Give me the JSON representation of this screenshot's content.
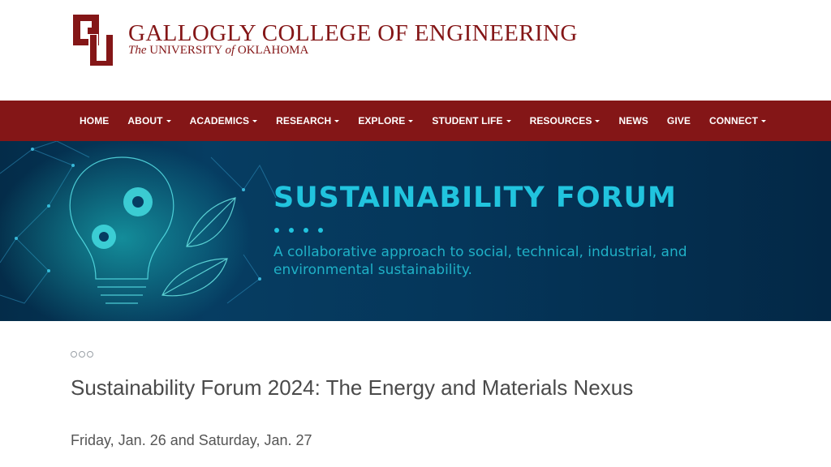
{
  "header": {
    "college_name": "GALLOGLY COLLEGE OF ENGINEERING",
    "university_prefix": "The",
    "university_mid": "UNIVERSITY",
    "university_of": "of",
    "university_state": "OKLAHOMA",
    "brand_color": "#841617"
  },
  "nav": {
    "items": [
      {
        "label": "HOME",
        "dropdown": false
      },
      {
        "label": "ABOUT",
        "dropdown": true
      },
      {
        "label": "ACADEMICS",
        "dropdown": true
      },
      {
        "label": "RESEARCH",
        "dropdown": true
      },
      {
        "label": "EXPLORE",
        "dropdown": true
      },
      {
        "label": "STUDENT LIFE",
        "dropdown": true
      },
      {
        "label": "RESOURCES",
        "dropdown": true
      },
      {
        "label": "NEWS",
        "dropdown": false
      },
      {
        "label": "GIVE",
        "dropdown": false
      },
      {
        "label": "CONNECT",
        "dropdown": true
      }
    ]
  },
  "banner": {
    "title": "SUSTAINABILITY FORUM",
    "subtitle": "A collaborative approach to social, technical, industrial, and environmental sustainability.",
    "accent_color": "#21c4de"
  },
  "content": {
    "title": "Sustainability Forum 2024: The Energy and Materials Nexus",
    "date": "Friday, Jan. 26 and Saturday, Jan. 27"
  }
}
